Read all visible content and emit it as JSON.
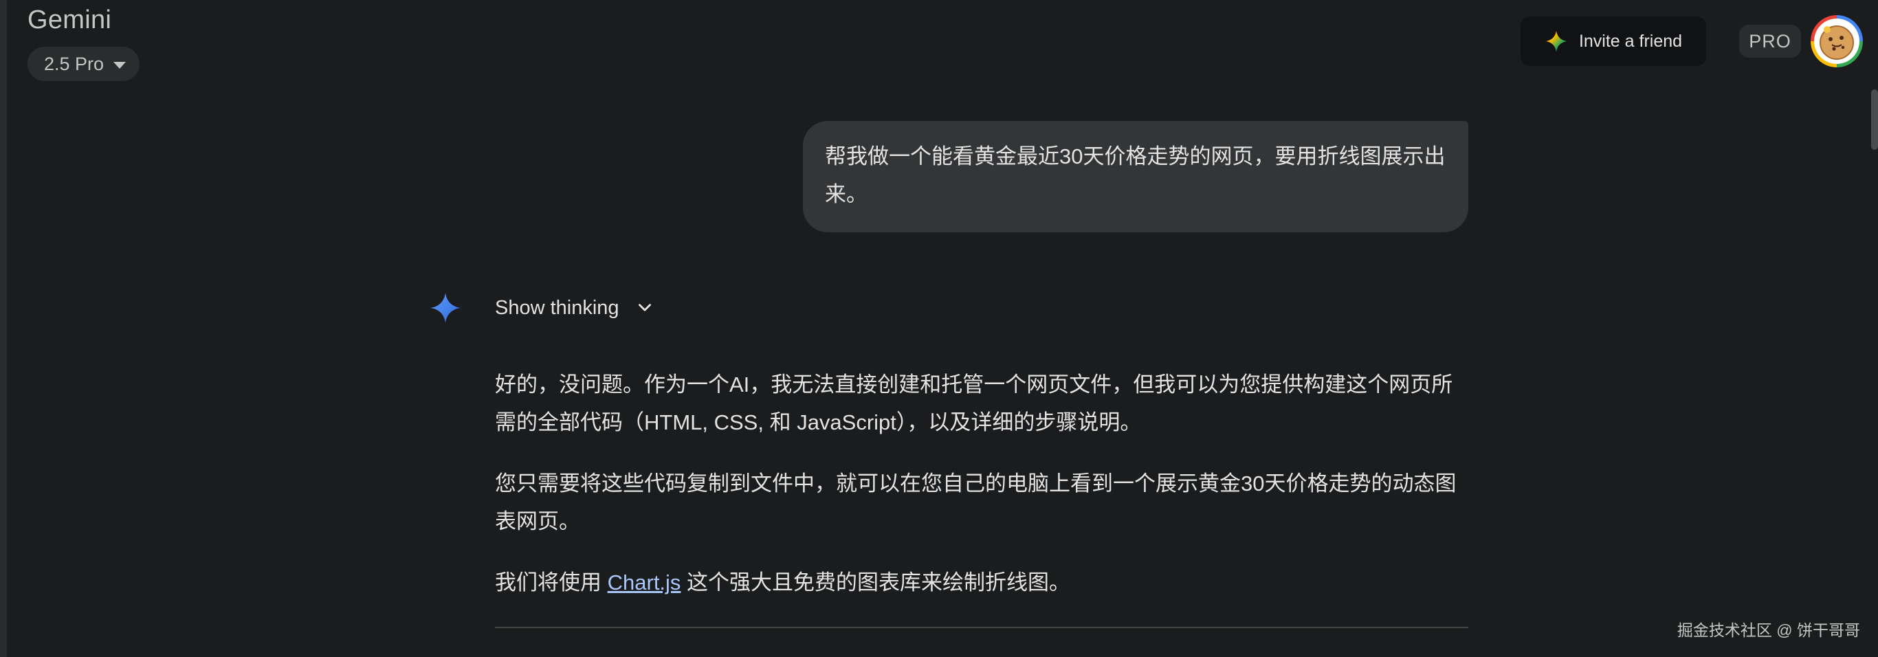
{
  "header": {
    "app_title": "Gemini",
    "model_label": "2.5 Pro",
    "invite_label": "Invite a friend",
    "pro_badge": "PRO"
  },
  "conversation": {
    "user_message": "帮我做一个能看黄金最近30天价格走势的网页，要用折线图展示出来。",
    "thinking_label": "Show thinking",
    "response": {
      "p1": "好的，没问题。作为一个AI，我无法直接创建和托管一个网页文件，但我可以为您提供构建这个网页所需的全部代码（HTML, CSS, 和 JavaScript），以及详细的步骤说明。",
      "p2": "您只需要将这些代码复制到文件中，就可以在您自己的电脑上看到一个展示黄金30天价格走势的动态图表网页。",
      "p3_before": "我们将使用 ",
      "p3_link": "Chart.js",
      "p3_after": " 这个强大且免费的图表库来绘制折线图。"
    }
  },
  "watermark": "掘金技术社区 @ 饼干哥哥",
  "icons": {
    "model_dropdown": "caret-down-icon",
    "invite": "sparkle-icon",
    "thinking": "gemini-spark-icon",
    "thinking_toggle": "chevron-down-icon",
    "avatar": "user-avatar"
  },
  "colors": {
    "background": "#1b1c1d",
    "bubble": "#333537",
    "link": "#a8c7fa",
    "spark_blue": "#4285f4"
  }
}
